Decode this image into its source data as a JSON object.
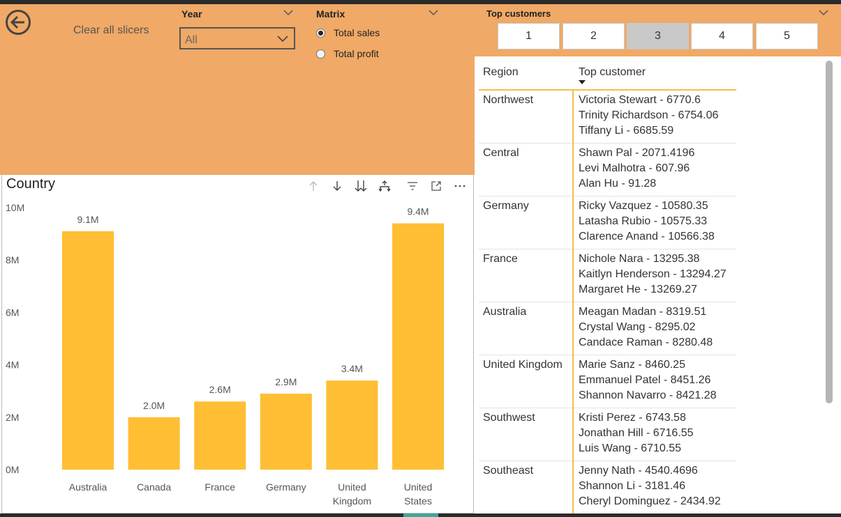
{
  "toolbar": {
    "clear_label": "Clear all slicers"
  },
  "year_slicer": {
    "title": "Year",
    "selected": "All"
  },
  "matrix_slicer": {
    "title": "Matrix",
    "options": [
      {
        "label": "Total sales",
        "selected": true
      },
      {
        "label": "Total profit",
        "selected": false
      }
    ]
  },
  "top_customers": {
    "title": "Top customers",
    "buttons": [
      "1",
      "2",
      "3",
      "4",
      "5"
    ],
    "selected": "3"
  },
  "colors": {
    "header_bg": "#f0a966",
    "bar": "#ffbe33",
    "accent_line": "#f2c04a"
  },
  "chart_data": {
    "type": "bar",
    "title": "Country",
    "categories": [
      "Australia",
      "Canada",
      "France",
      "Germany",
      "United Kingdom",
      "United States"
    ],
    "category_lines": [
      [
        "Australia"
      ],
      [
        "Canada"
      ],
      [
        "France"
      ],
      [
        "Germany"
      ],
      [
        "United",
        "Kingdom"
      ],
      [
        "United",
        "States"
      ]
    ],
    "values": [
      9.1,
      2.0,
      2.6,
      2.9,
      3.4,
      9.4
    ],
    "data_labels": [
      "9.1M",
      "2.0M",
      "2.6M",
      "2.9M",
      "3.4M",
      "9.4M"
    ],
    "y_ticks": [
      "0M",
      "2M",
      "4M",
      "6M",
      "8M",
      "10M"
    ],
    "ylim": [
      0,
      10
    ],
    "grid": false,
    "xlabel": "",
    "ylabel": ""
  },
  "table": {
    "headers": [
      "Region",
      "Top customer"
    ],
    "rows": [
      {
        "region": "Northwest",
        "customers": [
          "Victoria Stewart - 6770.6",
          "Trinity Richardson - 6754.06",
          "Tiffany Li - 6685.59"
        ]
      },
      {
        "region": "Central",
        "customers": [
          "Shawn Pal - 2071.4196",
          "Levi Malhotra - 607.96",
          "Alan Hu - 91.28"
        ]
      },
      {
        "region": "Germany",
        "customers": [
          "Ricky Vazquez - 10580.35",
          "Latasha Rubio - 10575.33",
          "Clarence Anand - 10566.38"
        ]
      },
      {
        "region": "France",
        "customers": [
          "Nichole Nara - 13295.38",
          "Kaitlyn Henderson - 13294.27",
          "Margaret He - 13269.27"
        ]
      },
      {
        "region": "Australia",
        "customers": [
          "Meagan Madan - 8319.51",
          "Crystal Wang - 8295.02",
          "Candace Raman - 8280.48"
        ]
      },
      {
        "region": "United Kingdom",
        "customers": [
          "Marie Sanz - 8460.25",
          "Emmanuel Patel - 8451.26",
          "Shannon Navarro - 8421.28"
        ]
      },
      {
        "region": "Southwest",
        "customers": [
          "Kristi Perez - 6743.58",
          "Jonathan Hill - 6716.55",
          "Luis Wang - 6710.55"
        ]
      },
      {
        "region": "Southeast",
        "customers": [
          "Jenny Nath - 4540.4696",
          "Shannon Li - 3181.46",
          "Cheryl Dominguez - 2434.92"
        ]
      }
    ]
  }
}
